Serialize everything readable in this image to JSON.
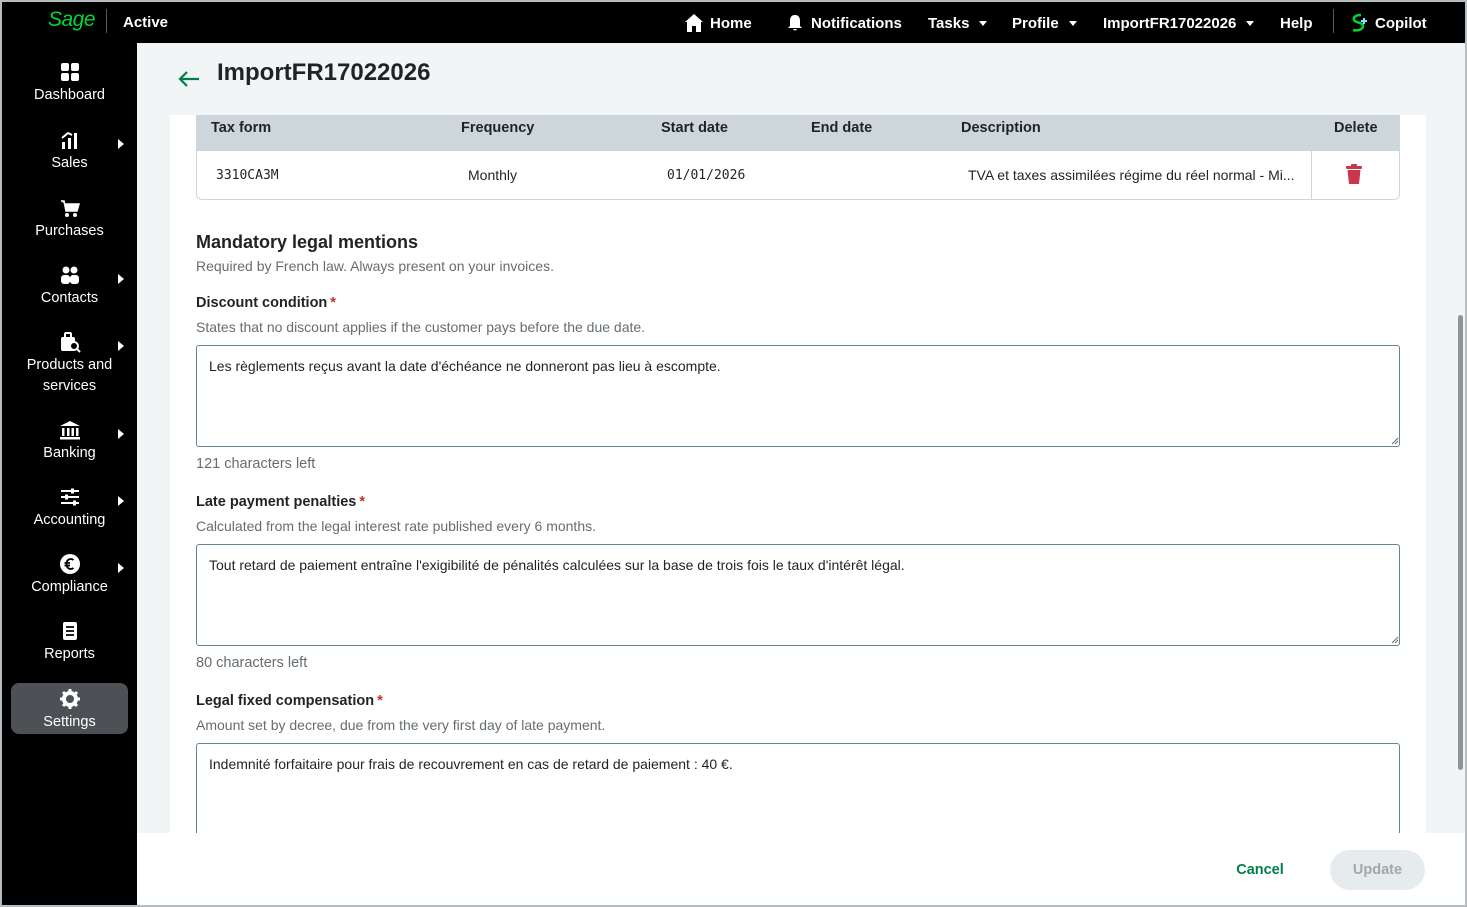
{
  "topbar": {
    "brand": "Sage",
    "company_status": "Active",
    "nav": {
      "home": "Home",
      "notifications": "Notifications",
      "tasks": "Tasks",
      "profile": "Profile",
      "company": "ImportFR17022026",
      "help": "Help",
      "copilot": "Copilot"
    }
  },
  "sidebar": {
    "items": [
      {
        "label": "Dashboard",
        "icon": "dashboard-icon",
        "has_submenu": false
      },
      {
        "label": "Sales",
        "icon": "sales-chart-icon",
        "has_submenu": true
      },
      {
        "label": "Purchases",
        "icon": "cart-icon",
        "has_submenu": false
      },
      {
        "label": "Contacts",
        "icon": "contacts-icon",
        "has_submenu": true
      },
      {
        "label": "Products and services",
        "icon": "products-icon",
        "has_submenu": true
      },
      {
        "label": "Banking",
        "icon": "bank-icon",
        "has_submenu": true
      },
      {
        "label": "Accounting",
        "icon": "sliders-icon",
        "has_submenu": true
      },
      {
        "label": "Compliance",
        "icon": "euro-icon",
        "has_submenu": true
      },
      {
        "label": "Reports",
        "icon": "report-icon",
        "has_submenu": false
      },
      {
        "label": "Settings",
        "icon": "gear-icon",
        "has_submenu": false,
        "active": true
      }
    ]
  },
  "page": {
    "title": "ImportFR17022026"
  },
  "tax_table": {
    "headers": {
      "tax_form": "Tax form",
      "frequency": "Frequency",
      "start_date": "Start date",
      "end_date": "End date",
      "description": "Description",
      "delete": "Delete"
    },
    "rows": [
      {
        "tax_form": "3310CA3M",
        "frequency": "Monthly",
        "start_date": "01/01/2026",
        "end_date": "",
        "description": "TVA et taxes assimilées régime du réel normal - Mi..."
      }
    ]
  },
  "legal_mentions": {
    "title": "Mandatory legal mentions",
    "subtitle": "Required by French law. Always present on your invoices.",
    "required_mark": "*",
    "discount": {
      "label": "Discount condition",
      "help": "States that no discount applies if the customer pays before the due date.",
      "value": "Les règlements reçus avant la date d'échéance ne donneront pas lieu à escompte.",
      "chars_left": "121 characters left"
    },
    "late_penalties": {
      "label": "Late payment penalties",
      "help": "Calculated from the legal interest rate published every 6 months.",
      "value": "Tout retard de paiement entraîne l'exigibilité de pénalités calculées sur la base de trois fois le taux d'intérêt légal.",
      "chars_left": "80 characters left"
    },
    "fixed_compensation": {
      "label": "Legal fixed compensation",
      "help": "Amount set by decree, due from the very first day of late payment.",
      "value": "Indemnité forfaitaire pour frais de recouvrement en cas de retard de paiement : 40 €."
    }
  },
  "footer": {
    "cancel": "Cancel",
    "update": "Update"
  },
  "colors": {
    "brand_green": "#00d639",
    "action_green": "#007e45",
    "required_red": "#c2312d",
    "delete_red": "#c7384f"
  }
}
